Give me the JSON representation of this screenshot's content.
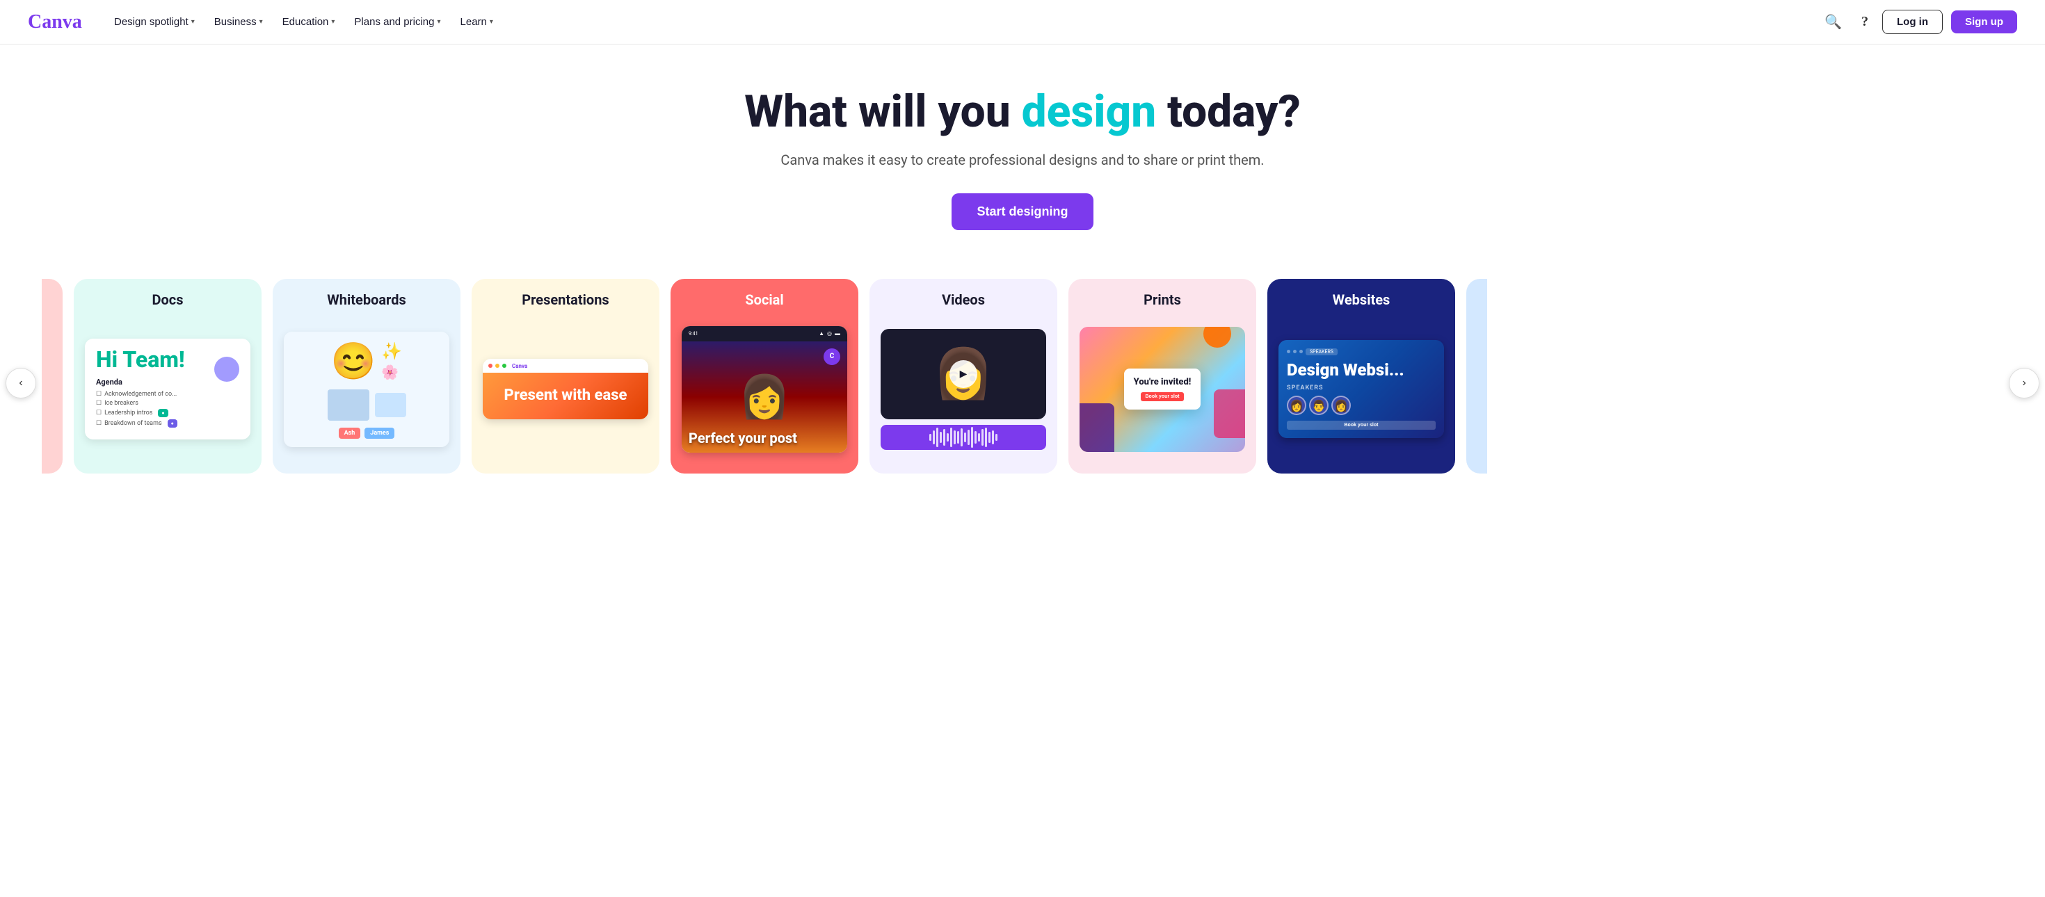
{
  "brand": {
    "name": "Canva",
    "logo_color": "#7c3aed",
    "logo_text": "Canva"
  },
  "nav": {
    "links": [
      {
        "id": "design-spotlight",
        "label": "Design spotlight",
        "has_dropdown": true
      },
      {
        "id": "business",
        "label": "Business",
        "has_dropdown": true
      },
      {
        "id": "education",
        "label": "Education",
        "has_dropdown": true
      },
      {
        "id": "plans-pricing",
        "label": "Plans and pricing",
        "has_dropdown": true
      },
      {
        "id": "learn",
        "label": "Learn",
        "has_dropdown": true
      }
    ],
    "search_aria": "Search",
    "help_aria": "Help",
    "login_label": "Log in",
    "signup_label": "Sign up"
  },
  "hero": {
    "title_prefix": "What will you ",
    "title_accent": "design",
    "title_suffix": " today?",
    "subtitle": "Canva makes it easy to create professional designs and to share or print them.",
    "cta_label": "Start designing"
  },
  "carousel": {
    "arrow_left": "‹",
    "arrow_right": "›",
    "cards": [
      {
        "id": "docs",
        "title": "Docs",
        "bg_color": "#e0faf5",
        "preview_headline": "Hi Team!",
        "preview_items": [
          "Acknowledgement of co...",
          "Ice breakers",
          "Leadership intros",
          "Breakdown of teams"
        ]
      },
      {
        "id": "whiteboards",
        "title": "Whiteboards",
        "bg_color": "#e8f4fd"
      },
      {
        "id": "presentations",
        "title": "Presentations",
        "bg_color": "#fff8e1",
        "preview_text": "Present with ease"
      },
      {
        "id": "social",
        "title": "Social",
        "bg_color": "#ff6b6b",
        "preview_text": "Perfect your post"
      },
      {
        "id": "videos",
        "title": "Videos",
        "bg_color": "#f3f0ff"
      },
      {
        "id": "prints",
        "title": "Prints",
        "bg_color": "#fce4ec",
        "preview_title": "You're invited!",
        "preview_btn": "Book your slot"
      },
      {
        "id": "websites",
        "title": "Websites",
        "bg_color": "#1a237e",
        "preview_heading": "Design Websi...",
        "preview_speakers": "SPEAKERS",
        "preview_btn": "Book your slot"
      }
    ]
  }
}
